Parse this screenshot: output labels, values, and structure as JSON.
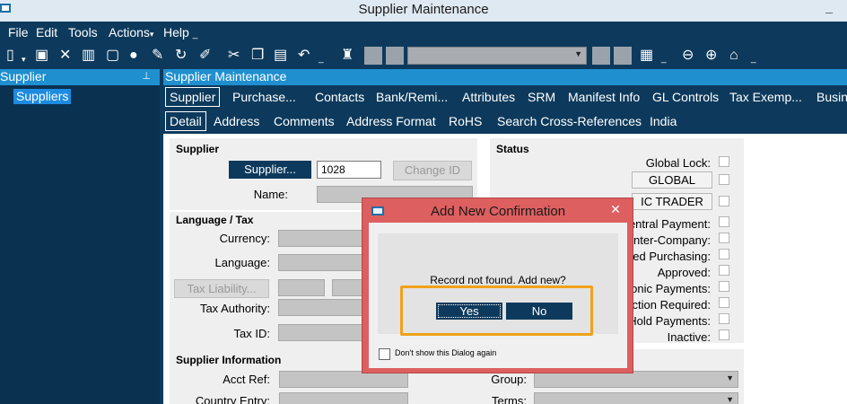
{
  "window": {
    "title": "Supplier Maintenance",
    "minimize_glyph": "_"
  },
  "menu": [
    {
      "label": "File"
    },
    {
      "label": "Edit"
    },
    {
      "label": "Tools"
    },
    {
      "label": "Actions",
      "arrow": "▾"
    },
    {
      "label": "Help",
      "arrow": "_"
    }
  ],
  "toolbar": {
    "icons": [
      "new-icon",
      "save-icon",
      "delete-icon",
      "book-icon",
      "note-icon",
      "comment-icon",
      "attach-icon",
      "refresh-icon",
      "clear-icon",
      "cut-icon",
      "copy-icon",
      "paste-icon",
      "undo-icon",
      "search-binoculars-icon",
      "first-record-icon",
      "prev-record-icon",
      "next-record-icon",
      "last-record-icon",
      "layout-icon",
      "back-icon",
      "forward-icon",
      "home-icon"
    ],
    "nav_combo_value": ""
  },
  "tree": {
    "header": "Supplier",
    "pin": "📌",
    "node": "Suppliers"
  },
  "main": {
    "header": "Supplier Maintenance",
    "tabs_top": [
      {
        "label": "Supplier",
        "active": true
      },
      {
        "label": "Purchase..."
      },
      {
        "label": "Contacts"
      },
      {
        "label": "Bank/Remi..."
      },
      {
        "label": "Attributes"
      },
      {
        "label": "SRM"
      },
      {
        "label": "Manifest Info"
      },
      {
        "label": "GL Controls"
      },
      {
        "label": "Tax Exemp..."
      },
      {
        "label": "Busin"
      }
    ],
    "tabs_sub": [
      {
        "label": "Detail",
        "active": true
      },
      {
        "label": "Address"
      },
      {
        "label": "Comments"
      },
      {
        "label": "Address Format"
      },
      {
        "label": "RoHS"
      },
      {
        "label": "Search Cross-References"
      },
      {
        "label": "India"
      }
    ]
  },
  "form": {
    "supplier_section": "Supplier",
    "supplier_button": "Supplier...",
    "supplier_id_value": "1028",
    "change_id_button": "Change ID",
    "name_label": "Name:",
    "lang_section": "Language / Tax",
    "currency_label": "Currency:",
    "language_label": "Language:",
    "tax_liability_button": "Tax Liability...",
    "tax_authority_label": "Tax Authority:",
    "tax_id_label": "Tax ID:",
    "supinfo_section": "Supplier Information",
    "acct_ref_label": "Acct Ref:",
    "country_entry_label": "Country Entry:",
    "group_label": "Group:",
    "terms_label": "Terms:",
    "status_section": "Status",
    "global_lock_label": "Global Lock:",
    "global_button": "GLOBAL",
    "ic_trader_button": "IC TRADER",
    "status_labels": [
      "Central Payment:",
      "Inter-Company:",
      "Linked Purchasing:",
      "Approved:",
      "Electronic Payments:",
      "Action Required:",
      "Hold Payments:",
      "Inactive:"
    ]
  },
  "dialog": {
    "title": "Add New Confirmation",
    "close": "✕",
    "message": "Record not found.  Add new?",
    "yes": "Yes",
    "no": "No",
    "dont_show": "Don't show this Dialog again",
    "highlight_color": "#f0a21a"
  }
}
